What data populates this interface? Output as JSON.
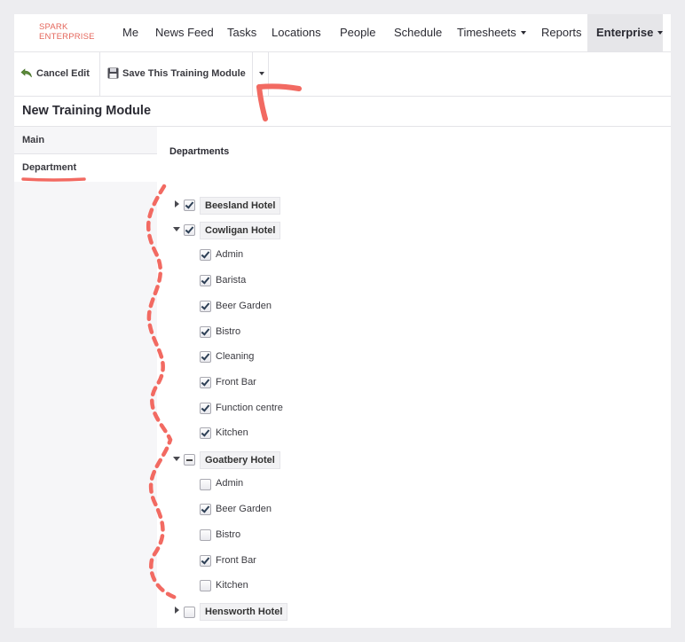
{
  "brand": {
    "line1": "SPARK",
    "line2": "ENTERPRISE",
    "color": "#e4665b"
  },
  "nav": {
    "items": [
      {
        "label": "Me"
      },
      {
        "label": "News Feed"
      },
      {
        "label": "Tasks"
      },
      {
        "label": "Locations"
      },
      {
        "label": "People"
      },
      {
        "label": "Schedule"
      },
      {
        "label": "Timesheets",
        "has_dropdown": true
      },
      {
        "label": "Reports"
      },
      {
        "label": "Enterprise",
        "has_dropdown": true,
        "active": true
      }
    ]
  },
  "toolbar": {
    "cancel_label": "Cancel Edit",
    "cancel_icon": "undo-arrow-icon",
    "save_label": "Save This Training Module",
    "save_icon": "floppy-disk-icon",
    "save_menu_icon": "caret-down-icon"
  },
  "page": {
    "title": "New Training Module"
  },
  "tabs": [
    {
      "label": "Main",
      "active": false
    },
    {
      "label": "Department",
      "active": true
    }
  ],
  "departments": {
    "heading": "Departments",
    "hotels": [
      {
        "name": "Beesland Hotel",
        "state": "checked",
        "expanded": false,
        "departments": []
      },
      {
        "name": "Cowligan Hotel",
        "state": "checked",
        "expanded": true,
        "departments": [
          {
            "name": "Admin",
            "checked": true
          },
          {
            "name": "Barista",
            "checked": true
          },
          {
            "name": "Beer Garden",
            "checked": true
          },
          {
            "name": "Bistro",
            "checked": true
          },
          {
            "name": "Cleaning",
            "checked": true
          },
          {
            "name": "Front Bar",
            "checked": true
          },
          {
            "name": "Function centre",
            "checked": true
          },
          {
            "name": "Kitchen",
            "checked": true
          }
        ]
      },
      {
        "name": "Goatbery Hotel",
        "state": "partial",
        "expanded": true,
        "departments": [
          {
            "name": "Admin",
            "checked": false
          },
          {
            "name": "Beer Garden",
            "checked": true
          },
          {
            "name": "Bistro",
            "checked": false
          },
          {
            "name": "Front Bar",
            "checked": true
          },
          {
            "name": "Kitchen",
            "checked": false
          }
        ]
      },
      {
        "name": "Hensworth Hotel",
        "state": "unchecked",
        "expanded": false,
        "departments": []
      }
    ]
  },
  "annotation_color": "#f26a62"
}
